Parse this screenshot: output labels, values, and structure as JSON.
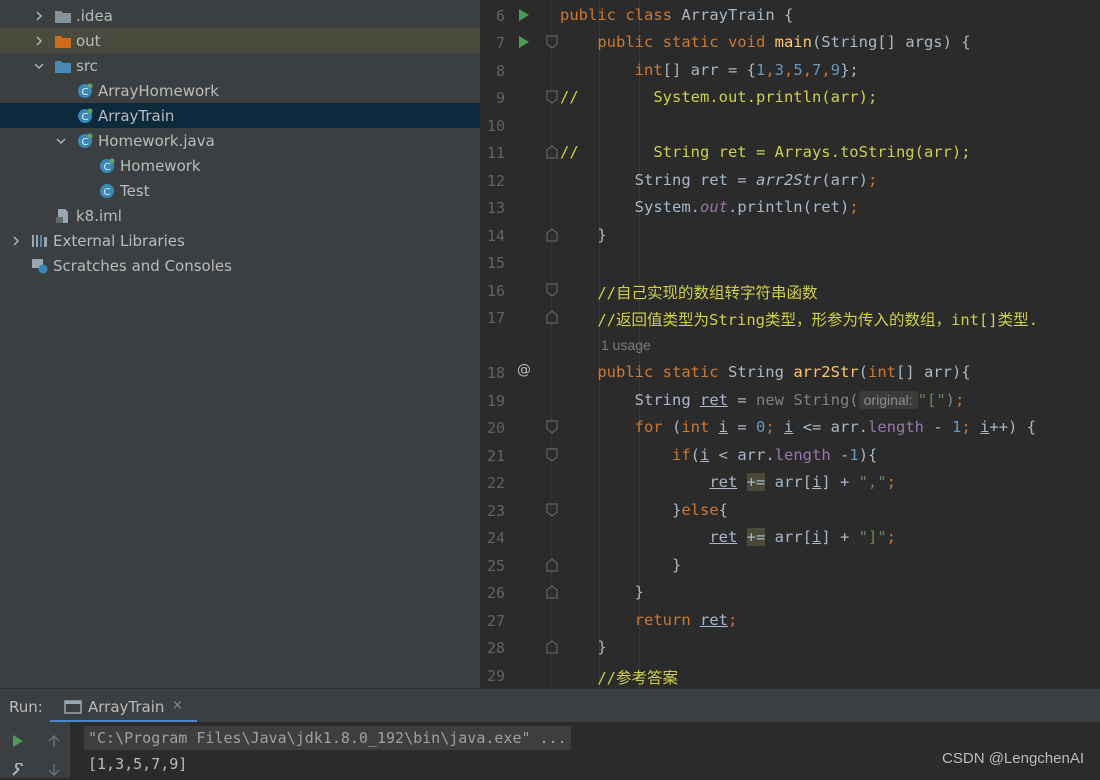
{
  "project_tree": {
    "items": [
      {
        "label": ".idea",
        "icon": "folder-icon"
      },
      {
        "label": "out",
        "icon": "folder-orange-icon"
      },
      {
        "label": "src",
        "icon": "source-folder-icon"
      },
      {
        "label": "ArrayHomework",
        "icon": "java-class-icon"
      },
      {
        "label": "ArrayTrain",
        "icon": "java-class-icon"
      },
      {
        "label": "Homework.java",
        "icon": "java-class-icon"
      },
      {
        "label": "Homework",
        "icon": "java-class-icon"
      },
      {
        "label": "Test",
        "icon": "java-class-icon"
      },
      {
        "label": "k8.iml",
        "icon": "module-file-icon"
      },
      {
        "label": "External Libraries",
        "icon": "libraries-icon"
      },
      {
        "label": "Scratches and Consoles",
        "icon": "scratches-icon"
      }
    ]
  },
  "editor": {
    "line_numbers": [
      "6",
      "7",
      "8",
      "9",
      "10",
      "11",
      "12",
      "13",
      "14",
      "15",
      "16",
      "17",
      "18",
      "19",
      "20",
      "21",
      "22",
      "23",
      "24",
      "25",
      "26",
      "27",
      "28",
      "29"
    ],
    "usage_hint": "1 usage",
    "param_hint": "original:",
    "lines": {
      "l6a": "public class ",
      "l6b": "ArrayTrain {",
      "l7a": "public static void ",
      "l7b": "main",
      "l7c": "(String[] args) {",
      "l8a": "int",
      "l8b": "[] arr = {",
      "l8c": "1",
      "l8d": ",",
      "l8e": "3",
      "l8f": ",",
      "l8g": "5",
      "l8h": ",",
      "l8i": "7",
      "l8j": ",",
      "l8k": "9",
      "l8l": "};",
      "l9": "//        System.out.println(arr);",
      "l11": "//        String ret = Arrays.toString(arr);",
      "l12a": "String ret = ",
      "l12b": "arr2Str",
      "l12c": "(arr)",
      "l12d": ";",
      "l13a": "System.",
      "l13b": "out",
      "l13c": ".println(ret)",
      "l13d": ";",
      "l14": "}",
      "l16": "//自己实现的数组转字符串函数",
      "l17": "//返回值类型为String类型，形参为传入的数组，int[]类型.",
      "l18a": "public static ",
      "l18b": "String ",
      "l18c": "arr2Str",
      "l18d": "(",
      "l18e": "int",
      "l18f": "[] arr){",
      "l19a": "String ",
      "l19b": "ret",
      "l19c": " = ",
      "l19d": "new ",
      "l19e": "String(",
      "l19f": "\"[\"",
      "l19g": ")",
      "l19h": ";",
      "l20a": "for ",
      "l20b": "(",
      "l20c": "int ",
      "l20d": "i",
      "l20e": " = ",
      "l20f": "0",
      "l20g": "; ",
      "l20h": "i",
      "l20i": " <= arr.",
      "l20j": "length",
      "l20k": " - ",
      "l20l": "1",
      "l20m": "; ",
      "l20n": "i",
      "l20o": "++) {",
      "l21a": "if",
      "l21b": "(",
      "l21c": "i",
      "l21d": " < arr.",
      "l21e": "length",
      "l21f": " -",
      "l21g": "1",
      "l21h": "){",
      "l22a": "ret",
      "l22b": " ",
      "l22c": "+=",
      "l22d": " arr[",
      "l22e": "i",
      "l22f": "] + ",
      "l22g": "\",\"",
      "l22h": ";",
      "l23a": "}",
      "l23b": "else",
      "l23c": "{",
      "l24a": "ret",
      "l24b": " ",
      "l24c": "+=",
      "l24d": " arr[",
      "l24e": "i",
      "l24f": "] + ",
      "l24g": "\"]\"",
      "l24h": ";",
      "l25": "}",
      "l26": "}",
      "l27a": "return ",
      "l27b": "ret",
      "l27c": ";",
      "l28": "}",
      "l29": "//参考答案"
    }
  },
  "run_panel": {
    "label": "Run:",
    "tab_name": "ArrayTrain",
    "tab_close": "×",
    "command": "\"C:\\Program Files\\Java\\jdk1.8.0_192\\bin\\java.exe\" ...",
    "output": "[1,3,5,7,9]",
    "watermark": "CSDN @LengchenAI"
  },
  "colors": {
    "keyword": "#cc7832",
    "number": "#6897bb",
    "string": "#6a8759",
    "comment": "#ced04a",
    "selection": "#0d293e",
    "run_icon": "#499c54"
  }
}
